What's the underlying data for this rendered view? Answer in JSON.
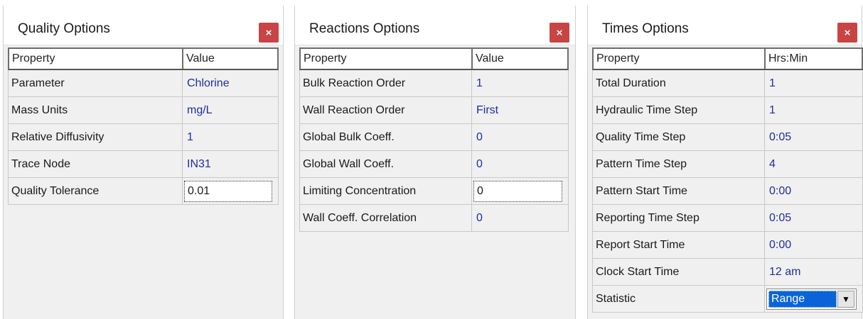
{
  "panels": [
    {
      "title": "Quality Options",
      "close": "×",
      "col_property": "Property",
      "col_value": "Value",
      "rows": [
        {
          "property": "Parameter",
          "value": "Chlorine"
        },
        {
          "property": "Mass Units",
          "value": "mg/L"
        },
        {
          "property": "Relative Diffusivity",
          "value": "1"
        },
        {
          "property": "Trace Node",
          "value": "IN31"
        },
        {
          "property": "Quality Tolerance",
          "value": "0.01"
        }
      ]
    },
    {
      "title": "Reactions Options",
      "close": "×",
      "col_property": "Property",
      "col_value": "Value",
      "rows": [
        {
          "property": "Bulk Reaction Order",
          "value": "1"
        },
        {
          "property": "Wall Reaction Order",
          "value": "First"
        },
        {
          "property": "Global Bulk Coeff.",
          "value": "0"
        },
        {
          "property": "Global Wall Coeff.",
          "value": "0"
        },
        {
          "property": "Limiting Concentration",
          "value": "0"
        },
        {
          "property": "Wall Coeff. Correlation",
          "value": "0"
        }
      ]
    },
    {
      "title": "Times Options",
      "close": "×",
      "col_property": "Property",
      "col_value": "Hrs:Min",
      "rows": [
        {
          "property": "Total Duration",
          "value": "1"
        },
        {
          "property": "Hydraulic Time Step",
          "value": "1"
        },
        {
          "property": "Quality Time Step",
          "value": "0:05"
        },
        {
          "property": "Pattern Time Step",
          "value": "4"
        },
        {
          "property": "Pattern Start Time",
          "value": "0:00"
        },
        {
          "property": "Reporting Time Step",
          "value": "0:05"
        },
        {
          "property": "Report Start Time",
          "value": "0:00"
        },
        {
          "property": "Clock Start Time",
          "value": "12 am"
        },
        {
          "property": "Statistic",
          "value": "Range"
        }
      ]
    }
  ],
  "colors": {
    "value_text": "#1d2f9e",
    "close_button": "#c94444",
    "selection": "#0a64d8"
  },
  "icons": {
    "close": "close-icon",
    "dropdown": "chevron-down-icon"
  }
}
